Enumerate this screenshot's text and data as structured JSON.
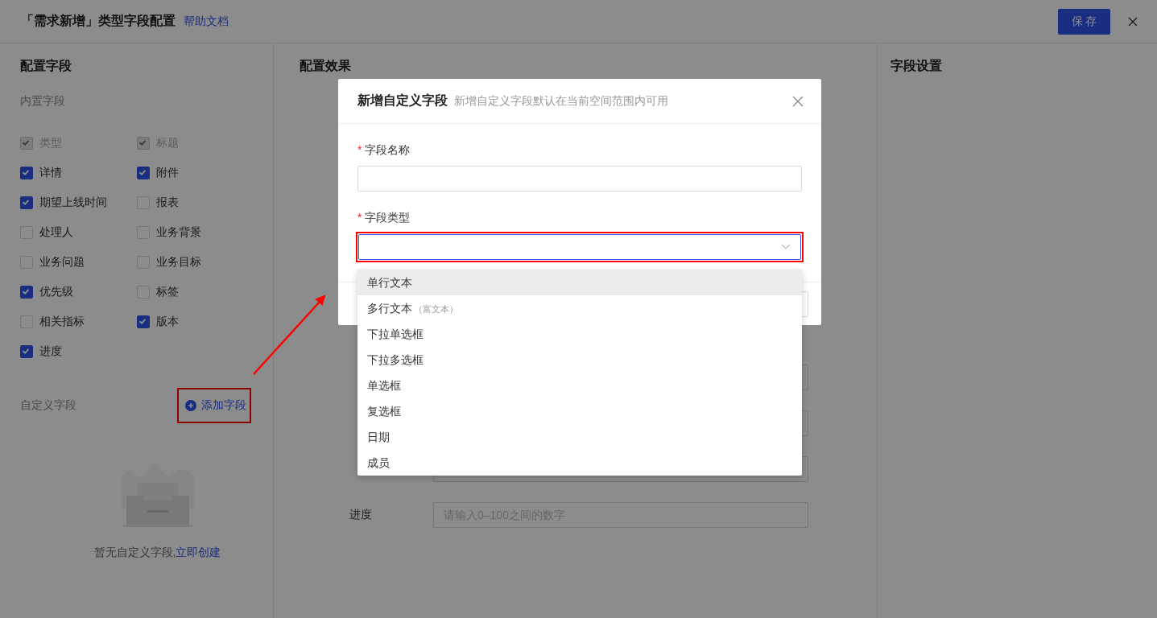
{
  "header": {
    "title": "「需求新增」类型字段配置",
    "help_link": "帮助文档",
    "save_button": "保 存"
  },
  "left_panel": {
    "title": "配置字段",
    "builtin_label": "内置字段",
    "builtin_fields": [
      {
        "label": "类型",
        "checked": true,
        "disabled": true
      },
      {
        "label": "标题",
        "checked": true,
        "disabled": true
      },
      {
        "label": "详情",
        "checked": true,
        "disabled": false
      },
      {
        "label": "附件",
        "checked": true,
        "disabled": false
      },
      {
        "label": "期望上线时间",
        "checked": true,
        "disabled": false
      },
      {
        "label": "报表",
        "checked": false,
        "disabled": false
      },
      {
        "label": "处理人",
        "checked": false,
        "disabled": false
      },
      {
        "label": "业务背景",
        "checked": false,
        "disabled": false
      },
      {
        "label": "业务问题",
        "checked": false,
        "disabled": false
      },
      {
        "label": "业务目标",
        "checked": false,
        "disabled": false
      },
      {
        "label": "优先级",
        "checked": true,
        "disabled": false
      },
      {
        "label": "标签",
        "checked": false,
        "disabled": false
      },
      {
        "label": "相关指标",
        "checked": false,
        "disabled": false
      },
      {
        "label": "版本",
        "checked": true,
        "disabled": false
      },
      {
        "label": "进度",
        "checked": true,
        "disabled": false
      }
    ],
    "custom_label": "自定义字段",
    "add_button": "添加字段",
    "empty_text": "暂无自定义字段,",
    "empty_link": "立即创建"
  },
  "middle_panel": {
    "title": "配置效果",
    "form_rows": [
      {
        "kind": "input"
      },
      {
        "kind": "input"
      },
      {
        "kind": "input"
      },
      {
        "label": "进度",
        "placeholder": "请输入0–100之间的数字"
      }
    ]
  },
  "right_panel": {
    "title": "字段设置"
  },
  "modal": {
    "title": "新增自定义字段",
    "subtitle": "新增自定义字段默认在当前空间范围内可用",
    "fields": [
      {
        "label": "字段名称",
        "required_mark": "*",
        "kind": "text",
        "focused": false
      },
      {
        "label": "字段类型",
        "required_mark": "*",
        "kind": "select",
        "focused": true
      }
    ]
  },
  "dropdown": {
    "options": [
      {
        "label": "单行文本",
        "selected": true
      },
      {
        "label": "多行文本",
        "note": "（富文本）",
        "selected": false
      },
      {
        "label": "下拉单选框",
        "selected": false
      },
      {
        "label": "下拉多选框",
        "selected": false
      },
      {
        "label": "单选框",
        "selected": false
      },
      {
        "label": "复选框",
        "selected": false
      },
      {
        "label": "日期",
        "selected": false
      },
      {
        "label": "成员",
        "selected": false
      }
    ]
  }
}
